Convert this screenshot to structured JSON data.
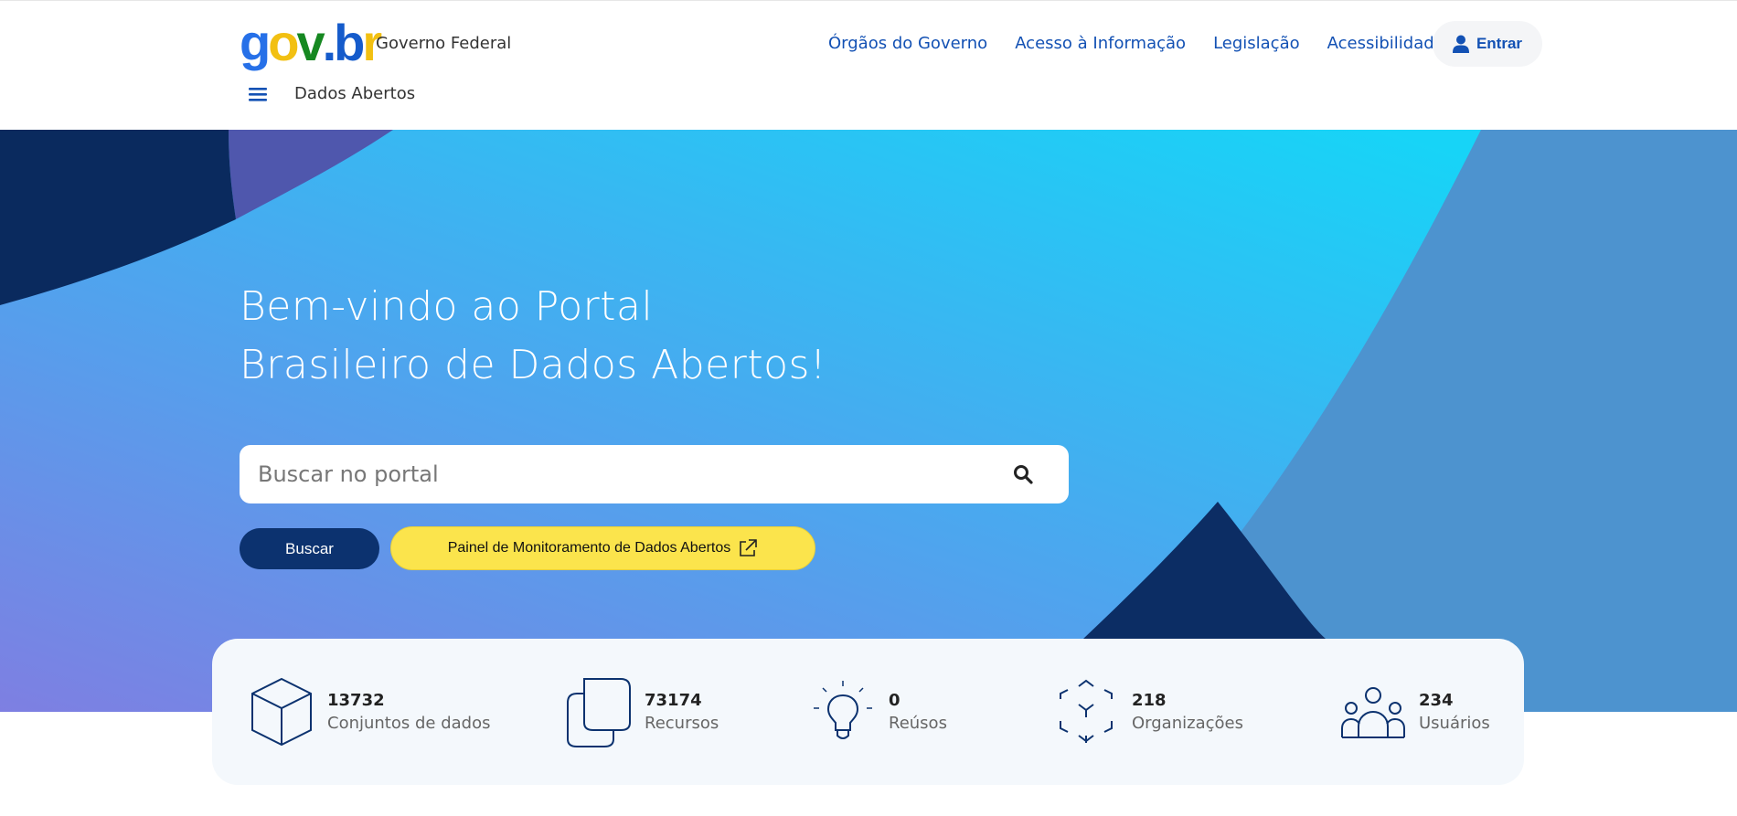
{
  "header": {
    "logo_parts": [
      "g",
      "o",
      "v",
      ".",
      "b",
      "r"
    ],
    "gov_label": "Governo Federal",
    "nav": [
      "Órgãos do Governo",
      "Acesso à Informação",
      "Legislação",
      "Acessibilidade"
    ],
    "login_label": "Entrar",
    "site_name": "Dados Abertos"
  },
  "hero": {
    "title_line1": "Bem-vindo ao Portal",
    "title_line2": "Brasileiro de Dados Abertos!",
    "search_placeholder": "Buscar no portal",
    "search_button": "Buscar",
    "panel_button": "Painel de Monitoramento de Dados Abertos"
  },
  "stats": [
    {
      "value": "13732",
      "label": "Conjuntos de dados",
      "icon": "cube-icon"
    },
    {
      "value": "73174",
      "label": "Recursos",
      "icon": "documents-icon"
    },
    {
      "value": "0",
      "label": "Reúsos",
      "icon": "lightbulb-icon"
    },
    {
      "value": "218",
      "label": "Organizações",
      "icon": "organization-cube-icon"
    },
    {
      "value": "234",
      "label": "Usuários",
      "icon": "users-icon"
    }
  ],
  "colors": {
    "primary": "#1351b4",
    "dark_blue": "#0c326f",
    "yellow": "#fbe44c",
    "hero_cyan": "#17d4f7",
    "hero_purple": "#7e7fe2"
  }
}
